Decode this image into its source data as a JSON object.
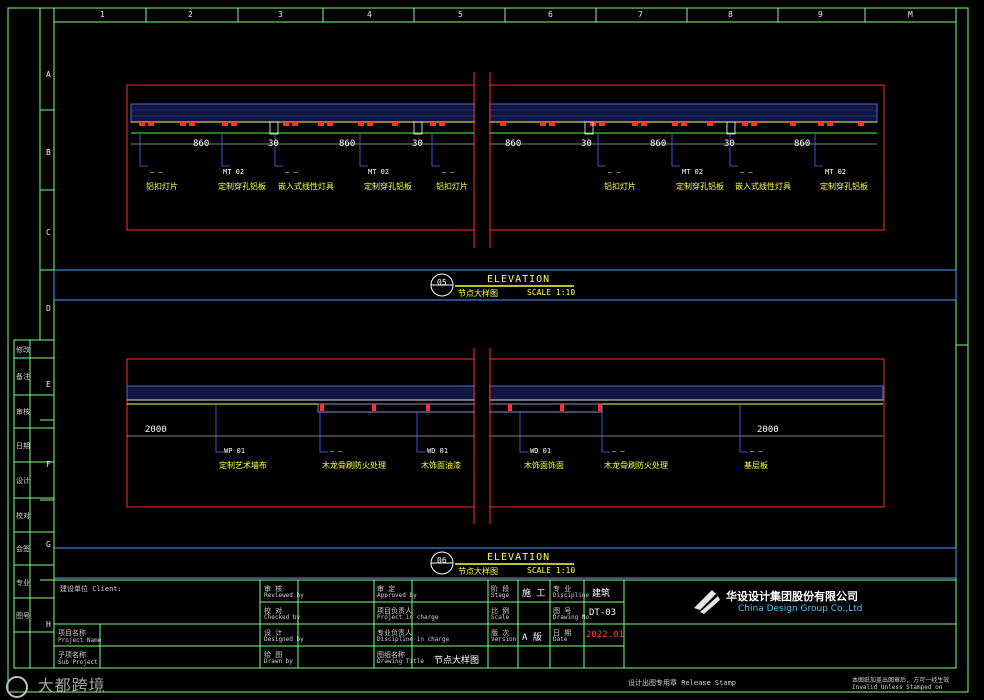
{
  "grid": {
    "columns": [
      "1",
      "2",
      "3",
      "4",
      "5",
      "6",
      "7",
      "8",
      "9",
      "M"
    ],
    "rows": [
      "A",
      "B",
      "C",
      "D",
      "E",
      "F",
      "G",
      "H"
    ]
  },
  "detail1": {
    "dimensions": [
      "860",
      "30",
      "860",
      "30",
      "860",
      "30",
      "860",
      "30",
      "860"
    ],
    "callouts": [
      {
        "tag": "— —",
        "label": "铝扣灯片"
      },
      {
        "tag": "MT 02",
        "label": "定制穿孔铝板"
      },
      {
        "tag": "— —",
        "label": "嵌入式线性灯具"
      },
      {
        "tag": "MT 02",
        "label": "定制穿孔铝板"
      },
      {
        "tag": "— —",
        "label": "铝扣灯片"
      },
      {
        "tag": "— —",
        "label": "铝扣灯片"
      },
      {
        "tag": "MT 02",
        "label": "定制穿孔铝板"
      },
      {
        "tag": "— —",
        "label": "嵌入式线性灯具"
      },
      {
        "tag": "MT 02",
        "label": "定制穿孔铝板"
      }
    ],
    "title": {
      "number": "05",
      "elevation": "ELEVATION",
      "name": "节点大样图",
      "scale": "SCALE 1:10"
    }
  },
  "detail2": {
    "dimensions": [
      "2000",
      "2000"
    ],
    "callouts": [
      {
        "tag": "WP 01",
        "label": "定制艺术墙布"
      },
      {
        "tag": "— —",
        "label": "木龙骨刷防火处理"
      },
      {
        "tag": "WD 01",
        "label": "木饰面油漆"
      },
      {
        "tag": "WD 01",
        "label": "木饰面饰面"
      },
      {
        "tag": "— —",
        "label": "木龙骨刷防火处理"
      },
      {
        "tag": "— —",
        "label": "基层板"
      }
    ],
    "title": {
      "number": "06",
      "elevation": "ELEVATION",
      "name": "节点大样图",
      "scale": "SCALE 1:10"
    }
  },
  "left_strip": [
    "修改",
    "备注",
    "审核",
    "日期",
    "设计",
    "校对",
    "会签",
    "专业",
    "图号"
  ],
  "title_block": {
    "client": "建设单位 Client:",
    "project_name": "项目名称",
    "project_name_en": "Project Name",
    "sub_project": "子项名称",
    "sub_project_en": "Sub Project",
    "approve": "审 核",
    "approve_en": "Reviewed by",
    "check": "校 对",
    "check_en": "Checked by",
    "design": "设 计",
    "design_en": "Designed by",
    "draw": "绘 图",
    "draw_en": "Drawn by",
    "examine": "审 定",
    "examine_en": "Approved by",
    "proj_lead": "项目负责人",
    "proj_lead_en": "Project in charge",
    "disc_lead": "专业负责人",
    "disc_lead_en": "Discipline in charge",
    "drawing_name_label": "图纸名称",
    "drawing_name_label_en": "Drawing Title",
    "drawing_name": "节点大样图",
    "stage_label": "阶 段",
    "stage_label_en": "Stage",
    "stage": "施 工",
    "discipline_label": "专 业",
    "discipline_label_en": "Discipline",
    "discipline": "建筑",
    "scale_label": "比 例",
    "scale_label_en": "Scale",
    "drawing_no_label": "图 号",
    "drawing_no_label_en": "Drawing No.",
    "drawing_no": "DT-03",
    "version_label": "版 次",
    "version_label_en": "Version",
    "version": "A 版",
    "date_label": "日 期",
    "date_label_en": "Date",
    "date": "2022.01",
    "company_cn": "华设设计集团股份有限公司",
    "company_en": "China Design Group Co.,Ltd",
    "stamp": "设计出图专用章 Release Stamp",
    "invalid_note_cn": "本图纸加盖出图章后, 方可一经生效",
    "invalid_note_en": "Invalid Unless Stamped on"
  },
  "watermark": "大都跨境"
}
